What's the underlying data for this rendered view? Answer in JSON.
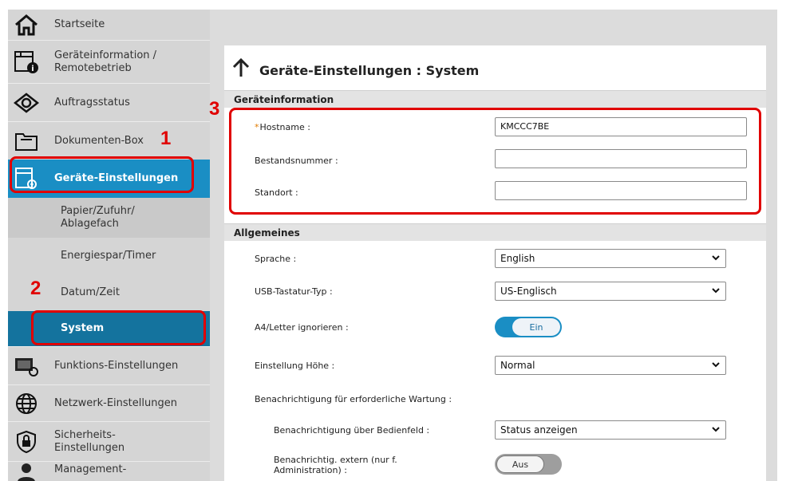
{
  "sidebar": {
    "items": [
      {
        "label": "Startseite",
        "icon": "home-icon"
      },
      {
        "label": "Geräteinformation / Remotebetrieb",
        "icon": "device-info-icon"
      },
      {
        "label": "Auftragsstatus",
        "icon": "eye-icon"
      },
      {
        "label": "Dokumenten-Box",
        "icon": "folder-icon"
      },
      {
        "label": "Geräte-Einstellungen",
        "icon": "device-settings-icon"
      },
      {
        "label": "Papier/Zufuhr/ Ablagefach"
      },
      {
        "label": "Energiespar/Timer"
      },
      {
        "label": "Datum/Zeit"
      },
      {
        "label": "System"
      },
      {
        "label": "Funktions-Einstellungen",
        "icon": "function-settings-icon"
      },
      {
        "label": "Netzwerk-Einstellungen",
        "icon": "globe-icon"
      },
      {
        "label": "Sicherheits- Einstellungen",
        "icon": "shield-lock-icon"
      },
      {
        "label": "Management-",
        "icon": "user-icon"
      }
    ]
  },
  "callouts": {
    "one": "1",
    "two": "2",
    "three": "3"
  },
  "page": {
    "title": "Geräte-Einstellungen : System",
    "sections": {
      "device_info": {
        "header": "Geräteinformation",
        "hostname_required": "*",
        "hostname_label": "Hostname :",
        "hostname_value": "KMCCC7BE",
        "asset_label": "Bestandsnummer :",
        "asset_value": "",
        "location_label": "Standort :",
        "location_value": ""
      },
      "general": {
        "header": "Allgemeines",
        "language_label": "Sprache :",
        "language_value": "English",
        "usb_label": "USB-Tastatur-Typ :",
        "usb_value": "US-Englisch",
        "a4_label": "A4/Letter ignorieren :",
        "a4_value": "Ein",
        "altitude_label": "Einstellung Höhe :",
        "altitude_value": "Normal",
        "maint_label": "Benachrichtigung für erforderliche Wartung :",
        "panel_notify_label": "Benachrichtigung über Bedienfeld :",
        "panel_notify_value": "Status anzeigen",
        "ext_notify_label_1": "Benachrichtig. extern (nur f.",
        "ext_notify_label_2": "Administration) :",
        "ext_notify_value": "Aus"
      }
    }
  },
  "colors": {
    "accent": "#1a8ec4",
    "active_sub": "#14739e",
    "callout_red": "#e00000"
  }
}
